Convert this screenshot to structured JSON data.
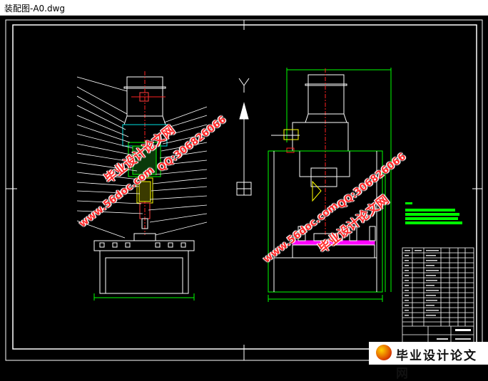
{
  "window": {
    "title": "装配图-A0.dwg"
  },
  "watermarks": {
    "site_cn": "毕业设计论文网",
    "site_url": "www.56doc.com",
    "qq": "QQ:306826066"
  },
  "logo": {
    "text": "毕业设计论文网",
    "url": "www.56doc.com"
  },
  "colors": {
    "background": "#000000",
    "line_white": "#ffffff",
    "green": "#00ff00",
    "yellow": "#ffff00",
    "magenta": "#ff00ff",
    "red": "#ff2020",
    "watermark": "#ff2a2a"
  }
}
